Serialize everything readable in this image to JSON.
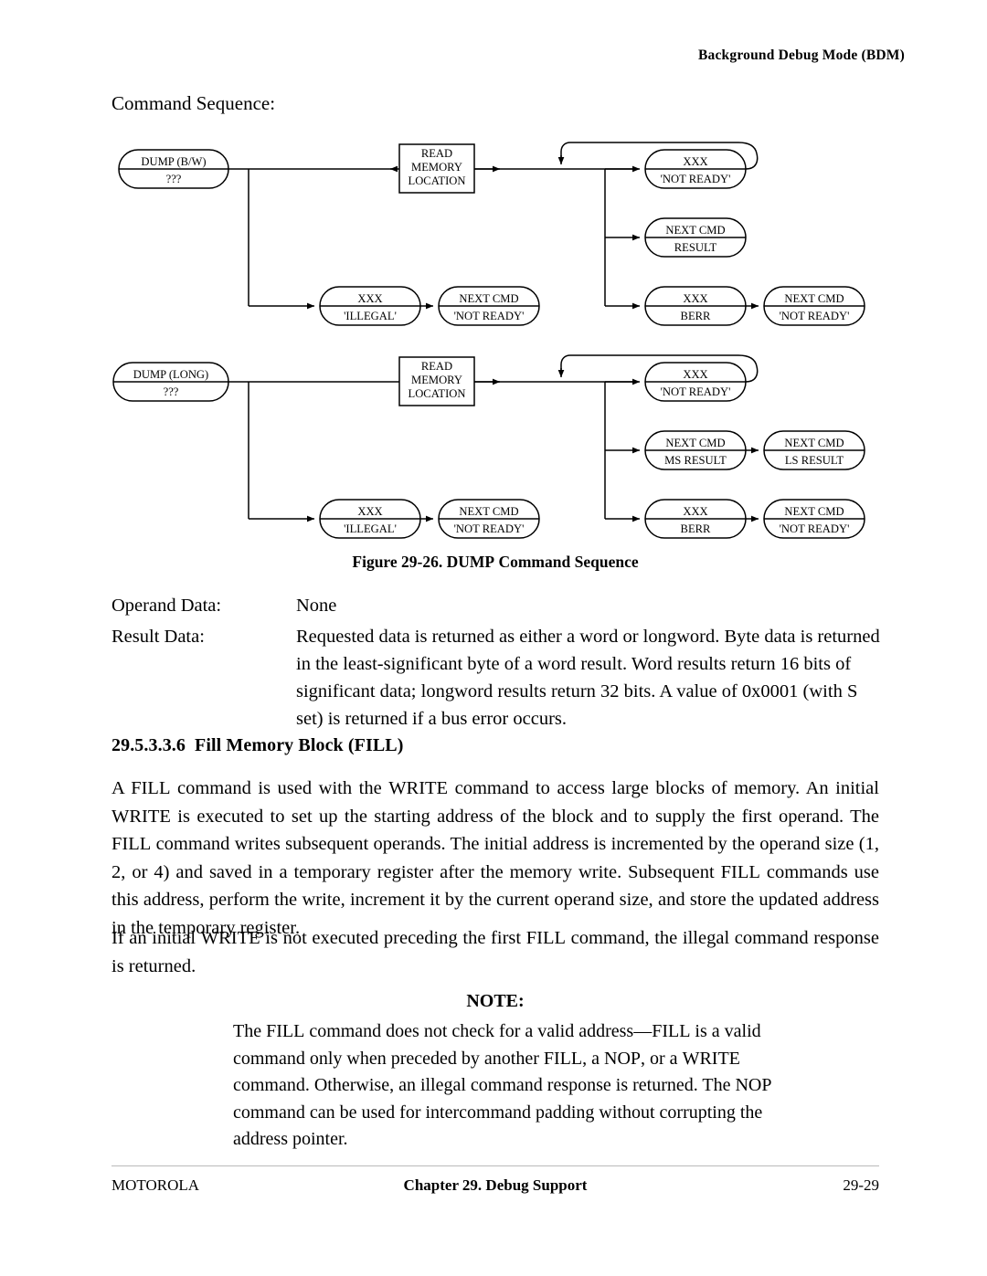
{
  "header": {
    "running_head": "Background Debug Mode (BDM)"
  },
  "lead": {
    "command_sequence_label": "Command Sequence:"
  },
  "figure": {
    "caption_prefix": "Figure 29-26.",
    "caption_smallcaps": "DUMP",
    "caption_suffix": "Command Sequence",
    "diagrams": [
      {
        "id": "dump-bw",
        "start": {
          "line1": "DUMP (B/W)",
          "line2": "???"
        },
        "process": {
          "line1": "READ",
          "line2": "MEMORY",
          "line3": "LOCATION"
        },
        "illegal": {
          "line1": "XXX",
          "line2": "'ILLEGAL'"
        },
        "illegal_next": {
          "line1": "NEXT CMD",
          "line2": "'NOT READY'"
        },
        "not_ready": {
          "line1": "XXX",
          "line2": "'NOT READY'"
        },
        "result": {
          "line1": "NEXT CMD",
          "line2": "RESULT"
        },
        "berr": {
          "line1": "XXX",
          "line2": "BERR"
        },
        "berr_next": {
          "line1": "NEXT CMD",
          "line2": "'NOT READY'"
        }
      },
      {
        "id": "dump-long",
        "start": {
          "line1": "DUMP (LONG)",
          "line2": "???"
        },
        "process": {
          "line1": "READ",
          "line2": "MEMORY",
          "line3": "LOCATION"
        },
        "illegal": {
          "line1": "XXX",
          "line2": "'ILLEGAL'"
        },
        "illegal_next": {
          "line1": "NEXT CMD",
          "line2": "'NOT READY'"
        },
        "not_ready": {
          "line1": "XXX",
          "line2": "'NOT READY'"
        },
        "ms_result": {
          "line1": "NEXT CMD",
          "line2": "MS RESULT"
        },
        "ls_result": {
          "line1": "NEXT CMD",
          "line2": "LS RESULT"
        },
        "berr": {
          "line1": "XXX",
          "line2": "BERR"
        },
        "berr_next": {
          "line1": "NEXT CMD",
          "line2": "'NOT READY'"
        }
      }
    ]
  },
  "definitions": [
    {
      "label": "Operand Data:",
      "value": "None"
    },
    {
      "label": "Result Data:",
      "value": "Requested data is returned as either a word or longword. Byte data is returned in the least-significant byte of a word result. Word results return 16 bits of significant data; longword results return 32 bits. A value of 0x0001 (with S set) is returned if a bus error occurs."
    }
  ],
  "section": {
    "number": "29.5.3.3.6",
    "title": "Fill Memory Block (",
    "title_smallcaps": "FILL",
    "title_close": ")"
  },
  "paragraphs": {
    "p1": {
      "s1": "A ",
      "sc1": "FILL",
      "s2": " command is used with the ",
      "sc2": "WRITE",
      "s3": " command to access large blocks of memory. An initial ",
      "sc3": "WRITE",
      "s4": " is executed to set up the starting address of the block and to supply the first operand. The ",
      "sc4": "FILL",
      "s5": " command writes subsequent operands. The initial address is incremented by the operand size (1, 2, or 4) and saved in a temporary register after the memory write. Subsequent ",
      "sc5": "FILL",
      "s6": " commands use this address, perform the write, increment it by the current operand size, and store the updated address in the temporary register."
    },
    "p2": {
      "s1": "If an initial ",
      "sc1": "WRITE",
      "s2": " is not executed preceding the first ",
      "sc2": "FILL",
      "s3": " command, the illegal command response is returned."
    }
  },
  "note": {
    "title": "NOTE:",
    "s1": "The ",
    "sc1": "FILL",
    "s2": " command does not check for a valid address—",
    "sc2": "FILL",
    "s3": " is a valid command only when preceded by another ",
    "sc3": "FILL",
    "s4": ", a ",
    "sc4": "NOP",
    "s5": ", or a ",
    "sc5": "WRITE",
    "s6": " command. Otherwise, an illegal command response is returned. The ",
    "sc6": "NOP",
    "s7": " command can be used for intercommand padding without corrupting the address pointer."
  },
  "footer": {
    "left": "MOTOROLA",
    "center": "Chapter 29. Debug Support",
    "right": "29-29"
  }
}
